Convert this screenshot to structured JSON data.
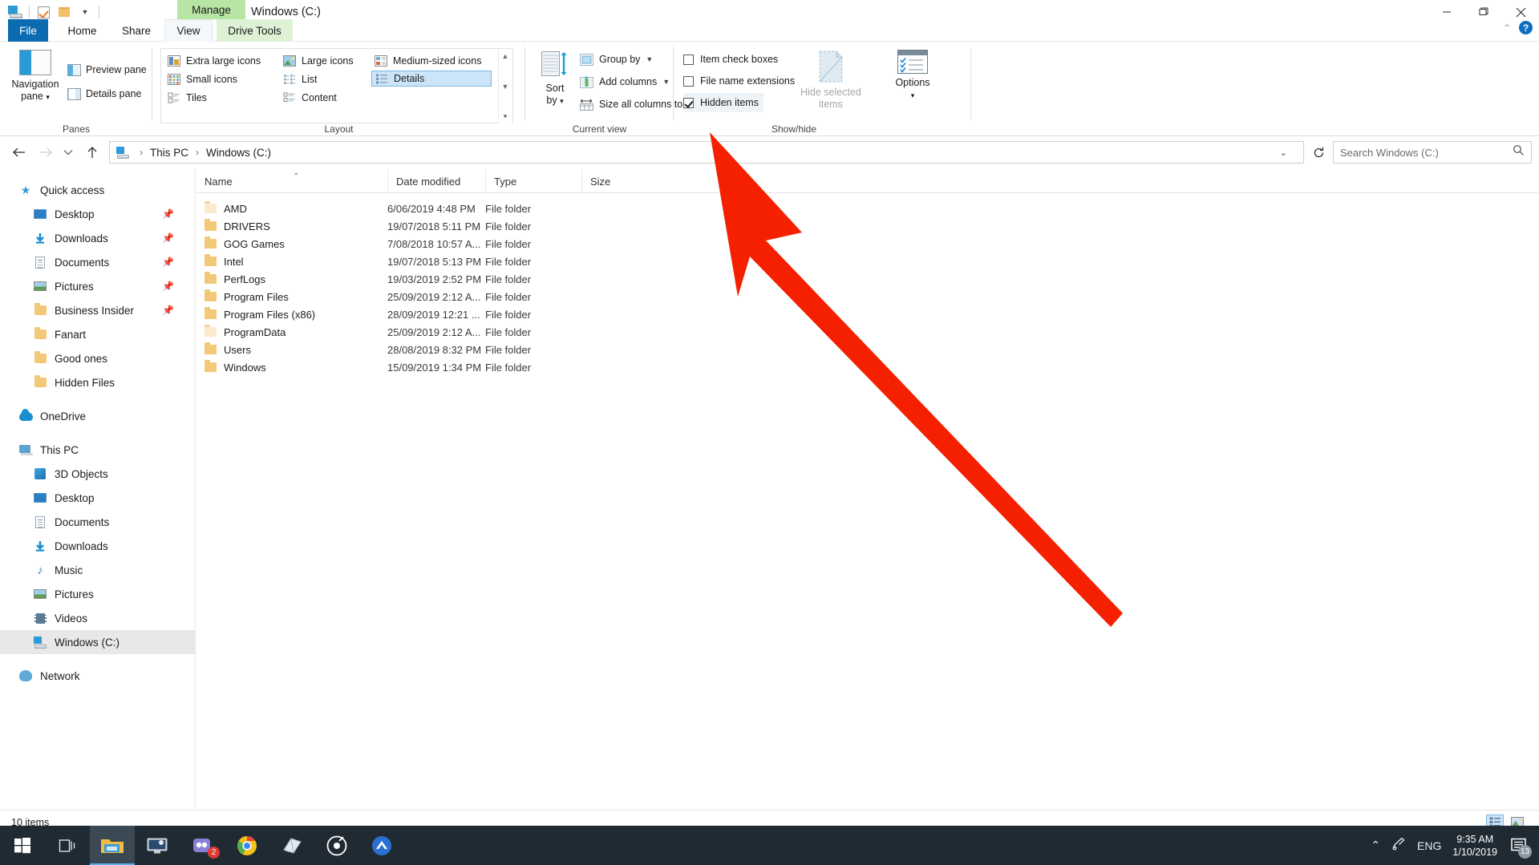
{
  "window": {
    "title": "Windows (C:)",
    "contextual_tab_top": "Manage",
    "quick_access_items": [
      "drive-icon",
      "properties-icon",
      "new-folder-icon",
      "customize-caret"
    ],
    "controls": {
      "minimize": "minimize-icon",
      "maximize": "maximize-icon",
      "close": "close-icon"
    }
  },
  "ribbon": {
    "tabs": [
      {
        "label": "File",
        "active": false
      },
      {
        "label": "Home",
        "active": false
      },
      {
        "label": "Share",
        "active": false
      },
      {
        "label": "View",
        "active": true
      },
      {
        "label": "Drive Tools",
        "active": false
      }
    ],
    "help": {
      "collapse": "chevron-up-icon",
      "help": "?"
    },
    "groups": [
      {
        "label": "Panes"
      },
      {
        "label": "Layout"
      },
      {
        "label": "Current view"
      },
      {
        "label": "Show/hide"
      }
    ],
    "panes": {
      "navigation_pane": "Navigation\npane",
      "navigation_pane_line1": "Navigation",
      "navigation_pane_line2": "pane",
      "preview_pane": "Preview pane",
      "details_pane": "Details pane"
    },
    "layout": {
      "items": [
        {
          "label": "Extra large icons",
          "selected": false
        },
        {
          "label": "Large icons",
          "selected": false
        },
        {
          "label": "Medium-sized icons",
          "selected": false
        },
        {
          "label": "Small icons",
          "selected": false
        },
        {
          "label": "List",
          "selected": false
        },
        {
          "label": "Details",
          "selected": true
        },
        {
          "label": "Tiles",
          "selected": false
        },
        {
          "label": "Content",
          "selected": false
        }
      ]
    },
    "current_view": {
      "sort_by_line1": "Sort",
      "sort_by_line2": "by",
      "group_by": "Group by",
      "add_columns": "Add columns",
      "size_all_columns": "Size all columns to fit"
    },
    "show_hide": {
      "item_check_boxes": {
        "label": "Item check boxes",
        "checked": false
      },
      "file_name_extensions": {
        "label": "File name extensions",
        "checked": false
      },
      "hidden_items": {
        "label": "Hidden items",
        "checked": true
      },
      "hide_selected_line1": "Hide selected",
      "hide_selected_line2": "items",
      "options": "Options"
    }
  },
  "addressbar": {
    "back": "back-arrow-icon",
    "forward": "forward-arrow-icon",
    "recent": "chevron-down-icon",
    "up": "up-arrow-icon",
    "breadcrumbs": [
      "This PC",
      "Windows (C:)"
    ],
    "refresh": "refresh-icon",
    "search_placeholder": "Search Windows (C:)"
  },
  "navpane": {
    "items": [
      {
        "label": "Quick access",
        "icon": "star-icon",
        "indent": 0,
        "pinned": false,
        "selected": false
      },
      {
        "label": "Desktop",
        "icon": "desktop-icon",
        "indent": 1,
        "pinned": true,
        "selected": false
      },
      {
        "label": "Downloads",
        "icon": "downloads-icon",
        "indent": 1,
        "pinned": true,
        "selected": false
      },
      {
        "label": "Documents",
        "icon": "documents-icon",
        "indent": 1,
        "pinned": true,
        "selected": false
      },
      {
        "label": "Pictures",
        "icon": "pictures-icon",
        "indent": 1,
        "pinned": true,
        "selected": false
      },
      {
        "label": "Business Insider",
        "icon": "folder-icon",
        "indent": 1,
        "pinned": true,
        "selected": false
      },
      {
        "label": "Fanart",
        "icon": "folder-icon",
        "indent": 1,
        "pinned": false,
        "selected": false
      },
      {
        "label": "Good ones",
        "icon": "folder-icon",
        "indent": 1,
        "pinned": false,
        "selected": false
      },
      {
        "label": "Hidden Files",
        "icon": "folder-icon",
        "indent": 1,
        "pinned": false,
        "selected": false
      },
      {
        "label": "OneDrive",
        "icon": "cloud-icon",
        "indent": 0,
        "pinned": false,
        "selected": false
      },
      {
        "label": "This PC",
        "icon": "pc-icon",
        "indent": 0,
        "pinned": false,
        "selected": false
      },
      {
        "label": "3D Objects",
        "icon": "3d-objects-icon",
        "indent": 1,
        "pinned": false,
        "selected": false
      },
      {
        "label": "Desktop",
        "icon": "desktop-icon",
        "indent": 1,
        "pinned": false,
        "selected": false
      },
      {
        "label": "Documents",
        "icon": "documents-icon",
        "indent": 1,
        "pinned": false,
        "selected": false
      },
      {
        "label": "Downloads",
        "icon": "downloads-icon",
        "indent": 1,
        "pinned": false,
        "selected": false
      },
      {
        "label": "Music",
        "icon": "music-icon",
        "indent": 1,
        "pinned": false,
        "selected": false
      },
      {
        "label": "Pictures",
        "icon": "pictures-icon",
        "indent": 1,
        "pinned": false,
        "selected": false
      },
      {
        "label": "Videos",
        "icon": "videos-icon",
        "indent": 1,
        "pinned": false,
        "selected": false
      },
      {
        "label": "Windows (C:)",
        "icon": "drive-icon",
        "indent": 1,
        "pinned": false,
        "selected": true
      },
      {
        "label": "Network",
        "icon": "network-icon",
        "indent": 0,
        "pinned": false,
        "selected": false
      }
    ]
  },
  "filelist": {
    "columns": [
      "Name",
      "Date modified",
      "Type",
      "Size"
    ],
    "sort_column": "Name",
    "sort_direction": "ascending",
    "rows": [
      {
        "name": "AMD",
        "date": "6/06/2019 4:48 PM",
        "type": "File folder",
        "size": "",
        "hidden": true
      },
      {
        "name": "DRIVERS",
        "date": "19/07/2018 5:11 PM",
        "type": "File folder",
        "size": "",
        "hidden": false
      },
      {
        "name": "GOG Games",
        "date": "7/08/2018 10:57 A...",
        "type": "File folder",
        "size": "",
        "hidden": false
      },
      {
        "name": "Intel",
        "date": "19/07/2018 5:13 PM",
        "type": "File folder",
        "size": "",
        "hidden": false
      },
      {
        "name": "PerfLogs",
        "date": "19/03/2019 2:52 PM",
        "type": "File folder",
        "size": "",
        "hidden": false
      },
      {
        "name": "Program Files",
        "date": "25/09/2019 2:12 A...",
        "type": "File folder",
        "size": "",
        "hidden": false
      },
      {
        "name": "Program Files (x86)",
        "date": "28/09/2019 12:21 ...",
        "type": "File folder",
        "size": "",
        "hidden": false
      },
      {
        "name": "ProgramData",
        "date": "25/09/2019 2:12 A...",
        "type": "File folder",
        "size": "",
        "hidden": true
      },
      {
        "name": "Users",
        "date": "28/08/2019 8:32 PM",
        "type": "File folder",
        "size": "",
        "hidden": false
      },
      {
        "name": "Windows",
        "date": "15/09/2019 1:34 PM",
        "type": "File folder",
        "size": "",
        "hidden": false
      }
    ]
  },
  "statusbar": {
    "item_count": "10 items",
    "view_details": "details-view-icon",
    "view_thumbnails": "thumbnails-view-icon"
  },
  "taskbar": {
    "start": "windows-start-icon",
    "task_view": "task-view-icon",
    "items": [
      {
        "name": "file-explorer-icon",
        "active": true,
        "badge": ""
      },
      {
        "name": "display-monitor-icon",
        "active": false,
        "badge": ""
      },
      {
        "name": "messaging-app-icon",
        "active": false,
        "badge": "2"
      },
      {
        "name": "google-chrome-icon",
        "active": false,
        "badge": ""
      },
      {
        "name": "sticky-notes-icon",
        "active": false,
        "badge": ""
      },
      {
        "name": "media-player-icon",
        "active": false,
        "badge": ""
      },
      {
        "name": "nordvpn-icon",
        "active": false,
        "badge": ""
      }
    ],
    "tray": {
      "show_hidden": "chevron-up-icon",
      "input_pen": "pen-icon",
      "language": "ENG",
      "time": "9:35 AM",
      "date": "1/10/2019",
      "notifications": "notification-icon",
      "notification_count": "13"
    }
  },
  "annotation": {
    "arrow_color": "#f52000",
    "points_to": "Hidden items"
  },
  "colors": {
    "accent": "#0b6ab0",
    "contextual_tab": "#b7e5a4",
    "selection": "#cce4f7",
    "taskbar": "#1f2a33"
  }
}
